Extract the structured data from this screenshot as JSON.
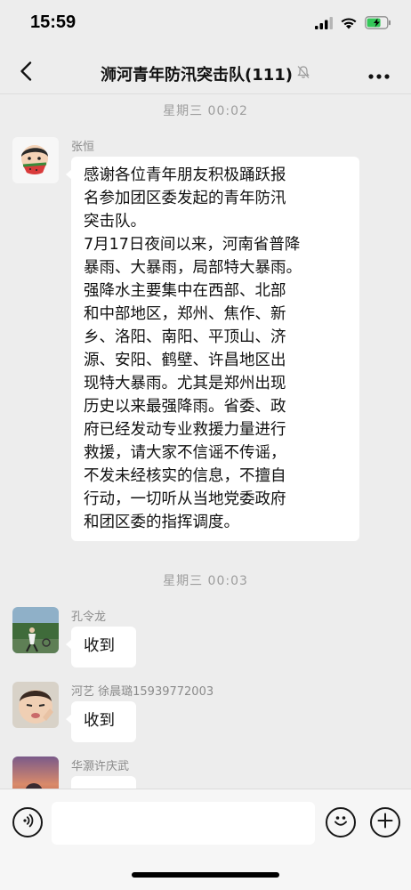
{
  "status_bar": {
    "time": "15:59"
  },
  "nav": {
    "title": "浉河青年防汛突击队(111)",
    "back_icon": "chevron-left-icon",
    "more_icon": "ellipsis-icon",
    "mute_icon": "bell-slash-icon"
  },
  "timestamps": [
    "星期三 00:02",
    "星期三 00:03"
  ],
  "messages": [
    {
      "sender": "张恒",
      "lines": [
        "感谢各位青年朋友积极踊跃报",
        "名参加团区委发起的青年防汛",
        "突击队。",
        "7月17日夜间以来，河南省普降",
        "暴雨、大暴雨，局部特大暴雨。",
        "强降水主要集中在西部、北部",
        "和中部地区，郑州、焦作、新",
        "乡、洛阳、南阳、平顶山、济",
        "源、安阳、鹤壁、许昌地区出",
        "现特大暴雨。尤其是郑州出现",
        "历史以来最强降雨。省委、政",
        "府已经发动专业救援力量进行",
        "救援，请大家不信谣不传谣，",
        "不发未经核实的信息，不擅自",
        "行动，一切听从当地党委政府",
        "和团区委的指挥调度。"
      ]
    },
    {
      "sender": "孔令龙",
      "text": "收到"
    },
    {
      "sender": "河艺 徐晨璐15939772003",
      "text": "收到"
    },
    {
      "sender": "华灏许庆武",
      "text": ""
    }
  ],
  "input_bar": {
    "voice_icon": "voice-icon",
    "emoji_icon": "emoji-icon",
    "plus_icon": "plus-icon"
  },
  "colors": {
    "background": "#ededed",
    "bubble": "#ffffff",
    "meta_text": "#9d9d9d",
    "battery_green": "#34c759"
  }
}
